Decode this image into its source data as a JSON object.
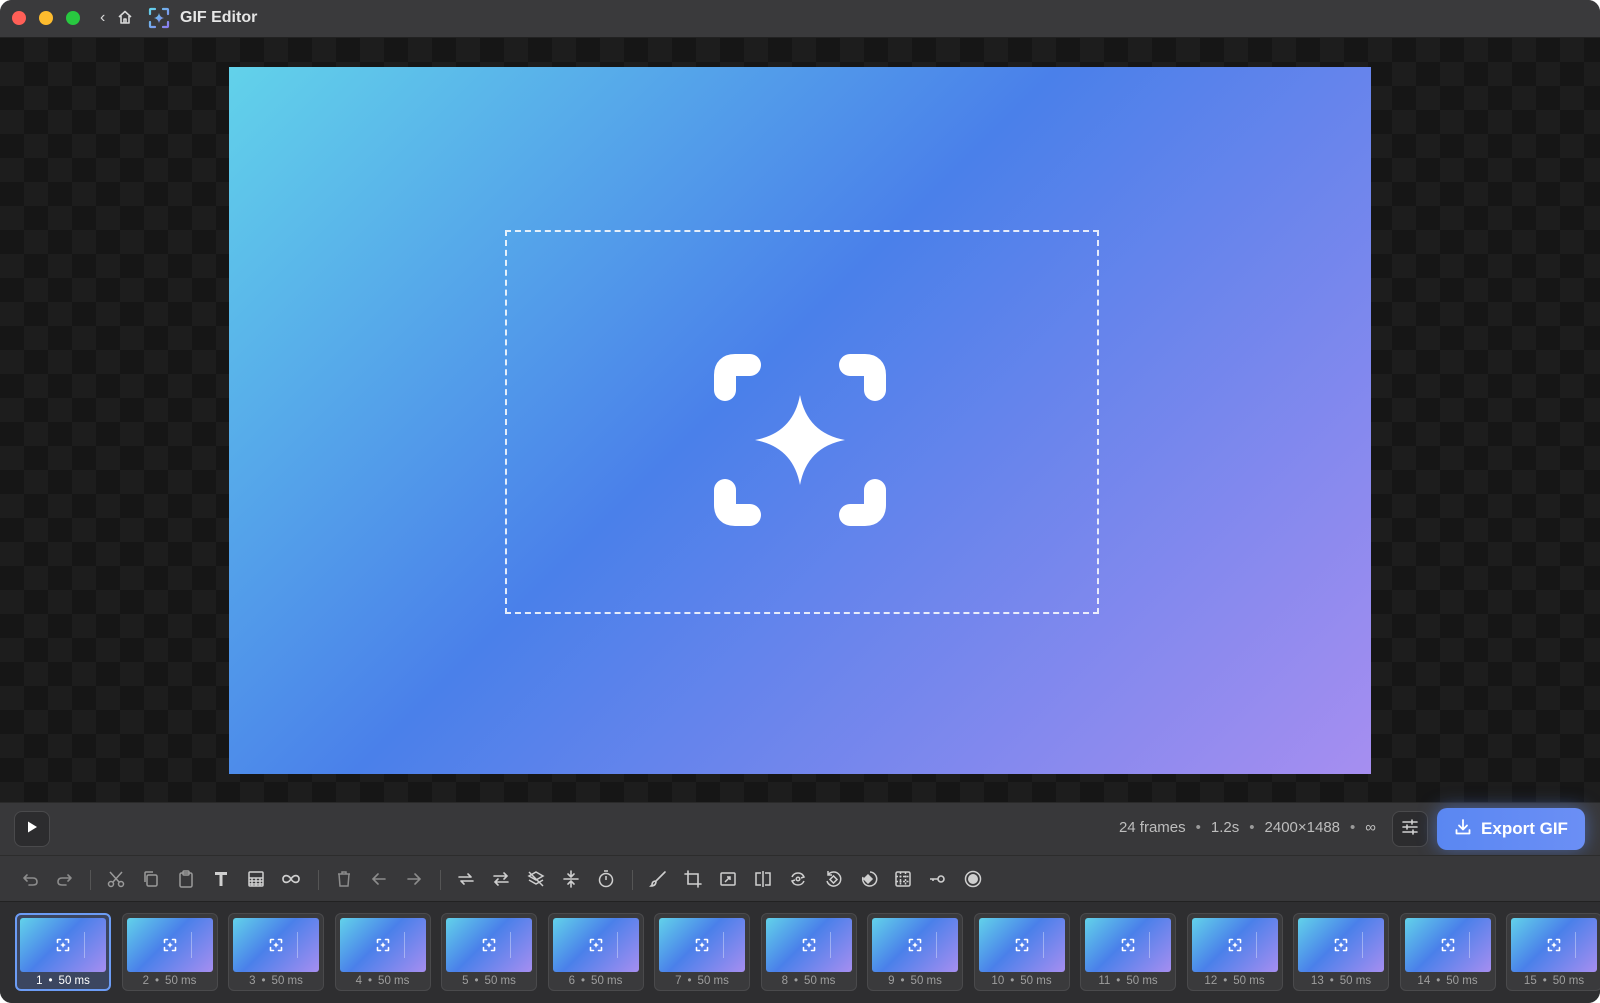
{
  "window": {
    "title": "GIF Editor",
    "controls": [
      "close",
      "minimize",
      "zoom"
    ],
    "nav": {
      "back_icon": "chevron-left-icon",
      "home_icon": "home-icon"
    },
    "app_icon": "capture-sparkle-icon"
  },
  "canvas": {
    "background": "checkerboard",
    "gradient": [
      "#62d2ea",
      "#4a80ea",
      "#a68ef0"
    ],
    "center_icon": "capture-sparkle-icon",
    "selection_style": "dashed"
  },
  "controls": {
    "play_icon": "play-icon",
    "frames": "24 frames",
    "duration": "1.2s",
    "dimensions": "2400×1488",
    "loop": "∞",
    "separator": "•",
    "settings_icon": "sliders-icon",
    "export_label": "Export GIF",
    "export_icon": "download-icon",
    "accent": "#5a87f2"
  },
  "toolbar": {
    "tools": [
      {
        "name": "undo",
        "icon": "undo-icon"
      },
      {
        "name": "redo",
        "icon": "redo-icon"
      },
      {
        "name": "cut",
        "icon": "scissors-icon"
      },
      {
        "name": "copy",
        "icon": "copy-icon"
      },
      {
        "name": "paste",
        "icon": "clipboard-icon"
      },
      {
        "name": "text",
        "icon": "text-icon"
      },
      {
        "name": "overlay",
        "icon": "pattern-icon"
      },
      {
        "name": "loop",
        "icon": "infinity-icon"
      },
      {
        "name": "delete",
        "icon": "trash-icon"
      },
      {
        "name": "move-left",
        "icon": "arrow-left-icon"
      },
      {
        "name": "move-right",
        "icon": "arrow-right-icon"
      },
      {
        "name": "reverse",
        "icon": "swap-icon"
      },
      {
        "name": "yoyo",
        "icon": "repeat-icon"
      },
      {
        "name": "remove-duplicates",
        "icon": "layers-off-icon"
      },
      {
        "name": "reduce-frames",
        "icon": "compress-icon"
      },
      {
        "name": "frame-delay",
        "icon": "timer-icon"
      },
      {
        "name": "draw",
        "icon": "brush-icon"
      },
      {
        "name": "crop",
        "icon": "crop-icon"
      },
      {
        "name": "resize",
        "icon": "resize-icon"
      },
      {
        "name": "flip",
        "icon": "flip-icon"
      },
      {
        "name": "rotate",
        "icon": "rotate-icon"
      },
      {
        "name": "rotate-alt",
        "icon": "rotate-left-icon"
      },
      {
        "name": "erase",
        "icon": "eraser-icon"
      },
      {
        "name": "pixelate",
        "icon": "grid-icon"
      },
      {
        "name": "key-frame",
        "icon": "key-icon"
      },
      {
        "name": "record",
        "icon": "record-icon"
      }
    ]
  },
  "filmstrip": {
    "selected_index": 0,
    "frames": [
      {
        "number": "1",
        "delay": "50 ms"
      },
      {
        "number": "2",
        "delay": "50 ms"
      },
      {
        "number": "3",
        "delay": "50 ms"
      },
      {
        "number": "4",
        "delay": "50 ms"
      },
      {
        "number": "5",
        "delay": "50 ms"
      },
      {
        "number": "6",
        "delay": "50 ms"
      },
      {
        "number": "7",
        "delay": "50 ms"
      },
      {
        "number": "8",
        "delay": "50 ms"
      },
      {
        "number": "9",
        "delay": "50 ms"
      },
      {
        "number": "10",
        "delay": "50 ms"
      },
      {
        "number": "11",
        "delay": "50 ms"
      },
      {
        "number": "12",
        "delay": "50 ms"
      },
      {
        "number": "13",
        "delay": "50 ms"
      },
      {
        "number": "14",
        "delay": "50 ms"
      },
      {
        "number": "15",
        "delay": "50 ms"
      }
    ]
  }
}
